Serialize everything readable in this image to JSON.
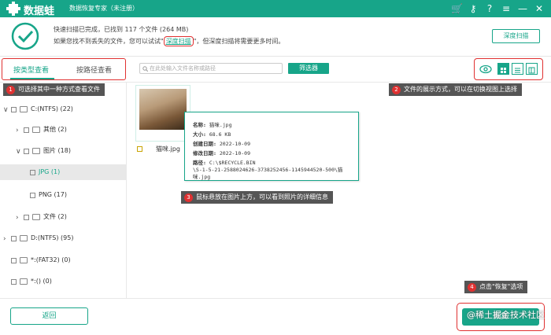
{
  "app": {
    "name": "数据蛙",
    "subtitle": "数据恢复专家（未注册）"
  },
  "titlebar": {
    "icons": [
      "cart-icon",
      "key-icon",
      "help-icon",
      "menu-icon",
      "minimize-icon",
      "close-icon"
    ]
  },
  "summary": {
    "line1": "快速扫描已完成，已找到 117 个文件 (264 MB)",
    "line2_before": "如果您找不到丢失的文件，您可以试试\"",
    "line2_link": "深度扫描",
    "line2_after": "\"，但深度扫描将需要更多时间。",
    "deep_scan_button": "深度扫描"
  },
  "tabs": {
    "by_type": "按类型查看",
    "by_path": "按路径查看"
  },
  "search": {
    "placeholder": "在此处输入文件名称或路径"
  },
  "filter_button": "筛选器",
  "sidebar": {
    "items": [
      {
        "label": "C:(NTFS) (22)"
      },
      {
        "label": "其他 (2)"
      },
      {
        "label": "图片 (18)"
      },
      {
        "label": "JPG (1)"
      },
      {
        "label": "PNG (17)"
      },
      {
        "label": "文件 (2)"
      },
      {
        "label": "D:(NTFS) (95)"
      },
      {
        "label": "*:(FAT32) (0)"
      },
      {
        "label": "*:() (0)"
      }
    ]
  },
  "file": {
    "name": "猫咪.jpg"
  },
  "popup": {
    "name_key": "名称:",
    "name_val": "猫咪.jpg",
    "size_key": "大小:",
    "size_val": "68.6 KB",
    "created_key": "创建日期:",
    "created_val": "2022-10-09",
    "modified_key": "修改日期:",
    "modified_val": "2022-10-09",
    "path_key": "路径:",
    "path_val1": "C:\\$RECYCLE.BIN",
    "path_val2": "\\S-1-5-21-2588024626-3738252456-1145944520-500\\猫",
    "path_val3": "咪.jpg"
  },
  "callouts": [
    {
      "num": "1",
      "text": "可选择其中一种方式查看文件"
    },
    {
      "num": "2",
      "text": "文件的展示方式，可以在切换视图上选择"
    },
    {
      "num": "3",
      "text": "鼠标悬放在图片上方，可以看到照片的详细信息"
    },
    {
      "num": "4",
      "text": "点击\"恢复\"选项"
    }
  ],
  "bottom": {
    "back": "返回",
    "recover": "恢复"
  },
  "watermark": "@稀土掘金技术社区",
  "colors": {
    "accent": "#17a589",
    "highlight": "#e03131"
  }
}
